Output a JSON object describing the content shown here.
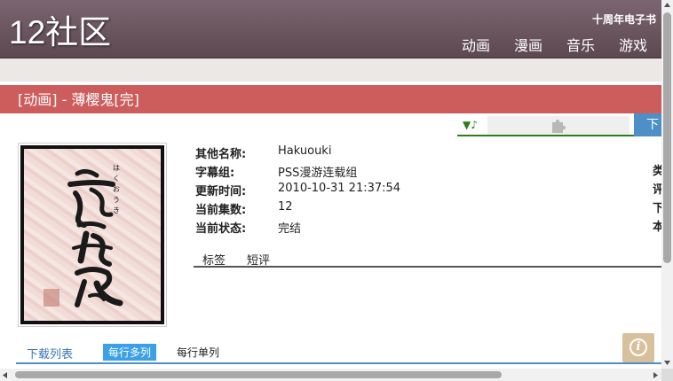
{
  "header": {
    "logo": "12社区",
    "toplink": "十周年电子书",
    "nav": [
      "动画",
      "漫画",
      "音乐",
      "游戏"
    ]
  },
  "title": "[动画] - 薄樱鬼[完]",
  "toolbar": {
    "music_label": "▼♪",
    "download_label": "下"
  },
  "info": [
    {
      "key": "其他名称:",
      "value": "Hakuouki"
    },
    {
      "key": "字幕组:",
      "value": "PSS漫游连载组"
    },
    {
      "key": "更新时间:",
      "value": "2010-10-31 21:37:54"
    },
    {
      "key": "当前集数:",
      "value": "12"
    },
    {
      "key": "当前状态:",
      "value": "完结"
    }
  ],
  "right_col": [
    "类",
    "评",
    "下",
    "本"
  ],
  "tabs": [
    "标签",
    "短评"
  ],
  "download_tabs": [
    "下载列表",
    "每行多列",
    "每行单列"
  ],
  "info_button": "i",
  "colors": {
    "title_bar": "#cd5c5c",
    "header": "#6e5862",
    "accent_blue": "#4f8fc7"
  }
}
